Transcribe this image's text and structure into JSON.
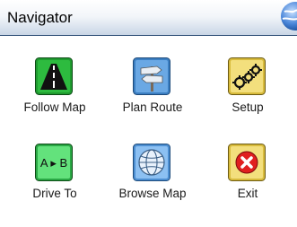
{
  "window": {
    "title": "Navigator",
    "logo_icon": "globe-logo-icon"
  },
  "menu": {
    "items": [
      {
        "label": "Follow Map",
        "icon": "road-icon",
        "color": "#1f9b2f"
      },
      {
        "label": "Plan Route",
        "icon": "signpost-icon",
        "color": "#4f94d4"
      },
      {
        "label": "Setup",
        "icon": "gears-icon",
        "color": "#f1d76a"
      },
      {
        "label": "Drive To",
        "icon": "a-to-b-icon",
        "glyph_text": "A ▸ B",
        "color": "#4fd36a"
      },
      {
        "label": "Browse Map",
        "icon": "globe-icon",
        "color": "#79b2ea"
      },
      {
        "label": "Exit",
        "icon": "close-circle-icon",
        "color": "#f1d76a"
      }
    ]
  }
}
